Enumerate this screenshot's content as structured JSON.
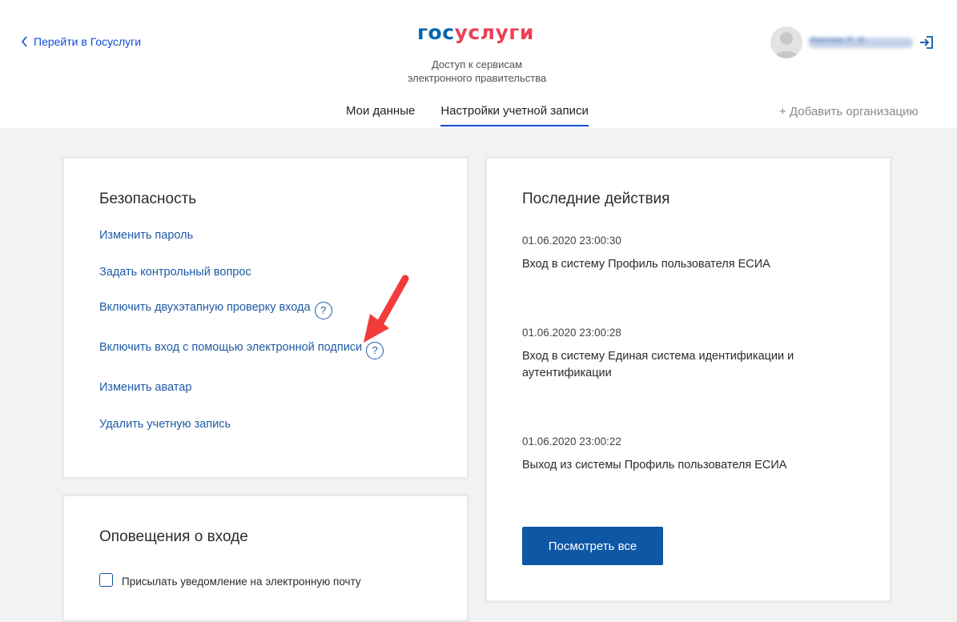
{
  "header": {
    "back_link": "Перейти в Госуслуги",
    "logo_gos": "гос",
    "logo_uslugi": "услуги",
    "logo_subtitle_1": "Доступ к сервисам",
    "logo_subtitle_2": "электронного правительства",
    "username": "Иванова И. И."
  },
  "tabs": [
    {
      "label": "Мои данные"
    },
    {
      "label": "Настройки учетной записи"
    }
  ],
  "add_org": "+ Добавить организацию",
  "security": {
    "title": "Безопасность",
    "links": [
      "Изменить пароль",
      "Задать контрольный вопрос",
      "Включить двухэтапную проверку входа",
      "Включить вход с помощью электронной подписи",
      "Изменить аватар",
      "Удалить учетную запись"
    ],
    "help_glyph": "?"
  },
  "notifications": {
    "title": "Оповещения о входе",
    "email_option": "Присылать уведомление на электронную почту"
  },
  "recent": {
    "title": "Последние действия",
    "items": [
      {
        "date": "01.06.2020 23:00:30",
        "text": "Вход в систему Профиль пользователя ЕСИА"
      },
      {
        "date": "01.06.2020 23:00:28",
        "text": "Вход в систему Единая система идентификации и аутентификации"
      },
      {
        "date": "01.06.2020 23:00:22",
        "text": "Выход из системы Профиль пользователя ЕСИА"
      }
    ],
    "view_all": "Посмотреть все"
  },
  "colors": {
    "accent": "#0d4cd3",
    "button": "#0d57a5",
    "arrow": "#f23b3b",
    "logo_blue": "#0066b3",
    "logo_red": "#ee3f58"
  }
}
